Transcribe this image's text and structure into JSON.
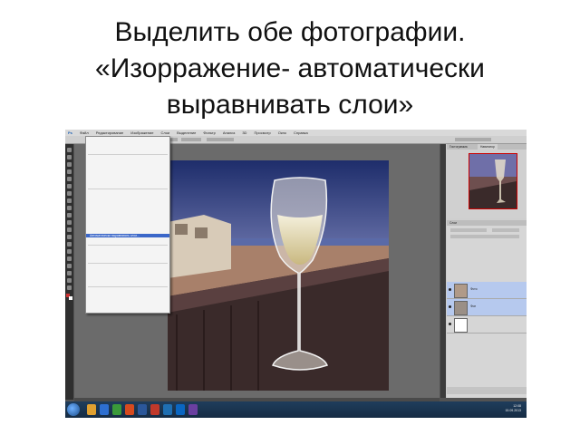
{
  "slide": {
    "title_line1": "Выделить обе фотографии.",
    "title_line2": "«Изорражение- автоматически",
    "title_line3": "выравнивать слои»"
  },
  "app": {
    "menubar": [
      "Ps",
      "Файл",
      "Редактирование",
      "Изображение",
      "Слои",
      "Выделение",
      "Фильтр",
      "Анализ",
      "3D",
      "Просмотр",
      "Окно",
      "Справка"
    ],
    "edit_menu": {
      "highlighted_item": "Автоматически выравнивать слои..."
    },
    "panels": {
      "navigator_tab": "Навигатор",
      "histogram_tab": "Гистограмма",
      "layers_tab": "Слои",
      "layer_items": [
        "Фото",
        "Фон"
      ]
    },
    "taskbar": {
      "time": "12:08",
      "date": "15.09.2013"
    },
    "colors": {
      "accent_highlight": "#3b67c9",
      "workspace": "#535353",
      "selected_layer": "#b6c9ee"
    }
  }
}
